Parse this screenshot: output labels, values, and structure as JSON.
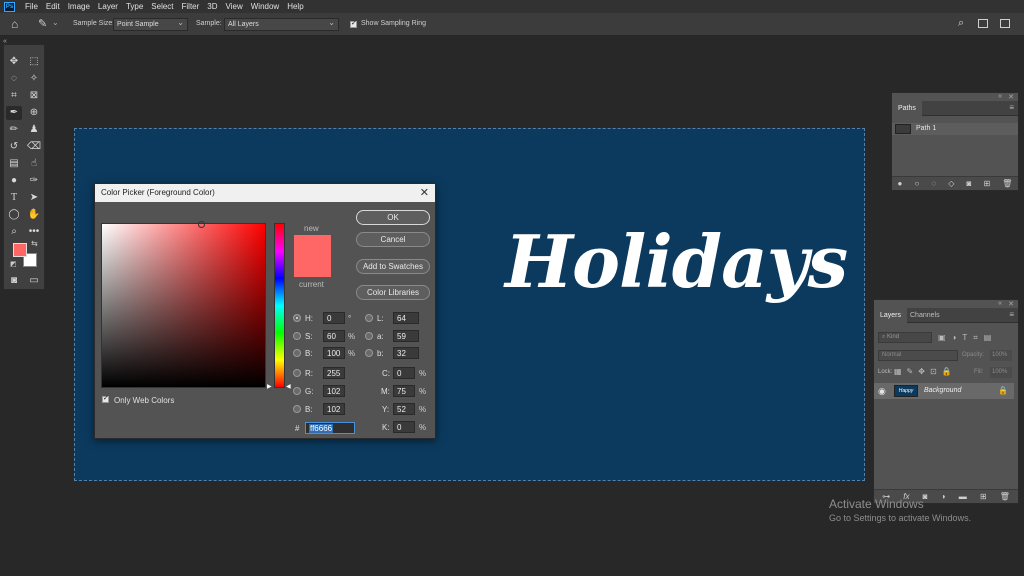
{
  "menubar": {
    "items": [
      "File",
      "Edit",
      "Image",
      "Layer",
      "Type",
      "Select",
      "Filter",
      "3D",
      "View",
      "Window",
      "Help"
    ]
  },
  "options": {
    "sample_size_label": "Sample Size:",
    "sample_size_value": "Point Sample",
    "sample_label": "Sample:",
    "sample_value": "All Layers",
    "show_ring_label": "Show Sampling Ring"
  },
  "canvas": {
    "text": "Holidays",
    "background_color": "#0b3a5e"
  },
  "paths_panel": {
    "tab": "Paths",
    "items": [
      {
        "label": "Path 1"
      }
    ]
  },
  "layers_panel": {
    "tabs": [
      "Layers",
      "Channels"
    ],
    "kind_placeholder": "Kind",
    "blend_mode": "Normal",
    "opacity_label": "Opacity:",
    "opacity_value": "100%",
    "lock_label": "Lock:",
    "fill_label": "Fill:",
    "fill_value": "100%",
    "layers": [
      {
        "name": "Background",
        "thumb_text": "Happy"
      }
    ]
  },
  "color_picker": {
    "title": "Color Picker (Foreground Color)",
    "new_label": "new",
    "current_label": "current",
    "new_color": "#ff6666",
    "current_color": "#ff6666",
    "buttons": {
      "ok": "OK",
      "cancel": "Cancel",
      "add_swatches": "Add to Swatches",
      "color_libraries": "Color Libraries"
    },
    "only_web_colors": "Only Web Colors",
    "fields": {
      "h": {
        "label": "H:",
        "value": "0",
        "unit": "°"
      },
      "s": {
        "label": "S:",
        "value": "60",
        "unit": "%"
      },
      "b": {
        "label": "B:",
        "value": "100",
        "unit": "%"
      },
      "r": {
        "label": "R:",
        "value": "255"
      },
      "g": {
        "label": "G:",
        "value": "102"
      },
      "bl": {
        "label": "B:",
        "value": "102"
      },
      "l": {
        "label": "L:",
        "value": "64"
      },
      "a": {
        "label": "a:",
        "value": "59"
      },
      "lb": {
        "label": "b:",
        "value": "32"
      },
      "c": {
        "label": "C:",
        "value": "0",
        "unit": "%"
      },
      "m": {
        "label": "M:",
        "value": "75",
        "unit": "%"
      },
      "y": {
        "label": "Y:",
        "value": "52",
        "unit": "%"
      },
      "k": {
        "label": "K:",
        "value": "0",
        "unit": "%"
      }
    },
    "hex_label": "#",
    "hex_value": "ff6666"
  },
  "toolbar": {
    "foreground_color": "#ff6666",
    "background_color": "#ffffff"
  },
  "watermark": {
    "line1": "Activate Windows",
    "line2": "Go to Settings to activate Windows."
  }
}
